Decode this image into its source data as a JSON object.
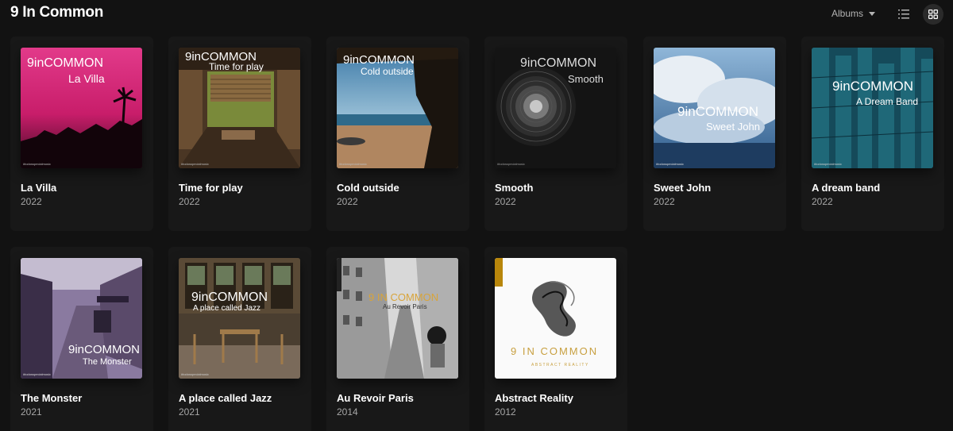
{
  "header": {
    "title": "9 In Common",
    "sort_label": "Albums",
    "list_view_icon": "list-icon",
    "grid_view_icon": "grid-icon"
  },
  "albums": [
    {
      "title": "La Villa",
      "year": "2022",
      "art_line1": "9inCOMMON",
      "art_line2": "La Villa",
      "art_tag": "#todosspecialmusic"
    },
    {
      "title": "Time for play",
      "year": "2022",
      "art_line1": "9inCOMMON",
      "art_line2": "Time for play",
      "art_tag": "#todosspecialmusic"
    },
    {
      "title": "Cold outside",
      "year": "2022",
      "art_line1": "9inCOMMON",
      "art_line2": "Cold outside",
      "art_tag": "#todosspecialmusic"
    },
    {
      "title": "Smooth",
      "year": "2022",
      "art_line1": "9inCOMMON",
      "art_line2": "Smooth",
      "art_tag": "#todosspecialmusic"
    },
    {
      "title": "Sweet John",
      "year": "2022",
      "art_line1": "9inCOMMON",
      "art_line2": "Sweet John",
      "art_tag": "#todosspecialmusic"
    },
    {
      "title": "A dream band",
      "year": "2022",
      "art_line1": "9inCOMMON",
      "art_line2": "A Dream Band",
      "art_tag": "#todosspecialmusic"
    },
    {
      "title": "The Monster",
      "year": "2021",
      "art_line1": "9inCOMMON",
      "art_line2": "The Monster",
      "art_tag": "#todosspecialmusic"
    },
    {
      "title": "A place called Jazz",
      "year": "2021",
      "art_line1": "9inCOMMON",
      "art_line2": "A place called Jazz",
      "art_tag": "#todosspecialmusic"
    },
    {
      "title": "Au Revoir Paris",
      "year": "2014",
      "art_line1": "9 IN COMMON",
      "art_line2": "Au Revoir Paris"
    },
    {
      "title": "Abstract Reality",
      "year": "2012",
      "art_line1": "9 IN COMMON",
      "art_line2": "ABSTRACT REALITY"
    }
  ],
  "colors": {
    "background": "#121212",
    "card": "#181818",
    "subtext": "#a7a7a7",
    "active_view_bg": "#2a2a2a"
  }
}
